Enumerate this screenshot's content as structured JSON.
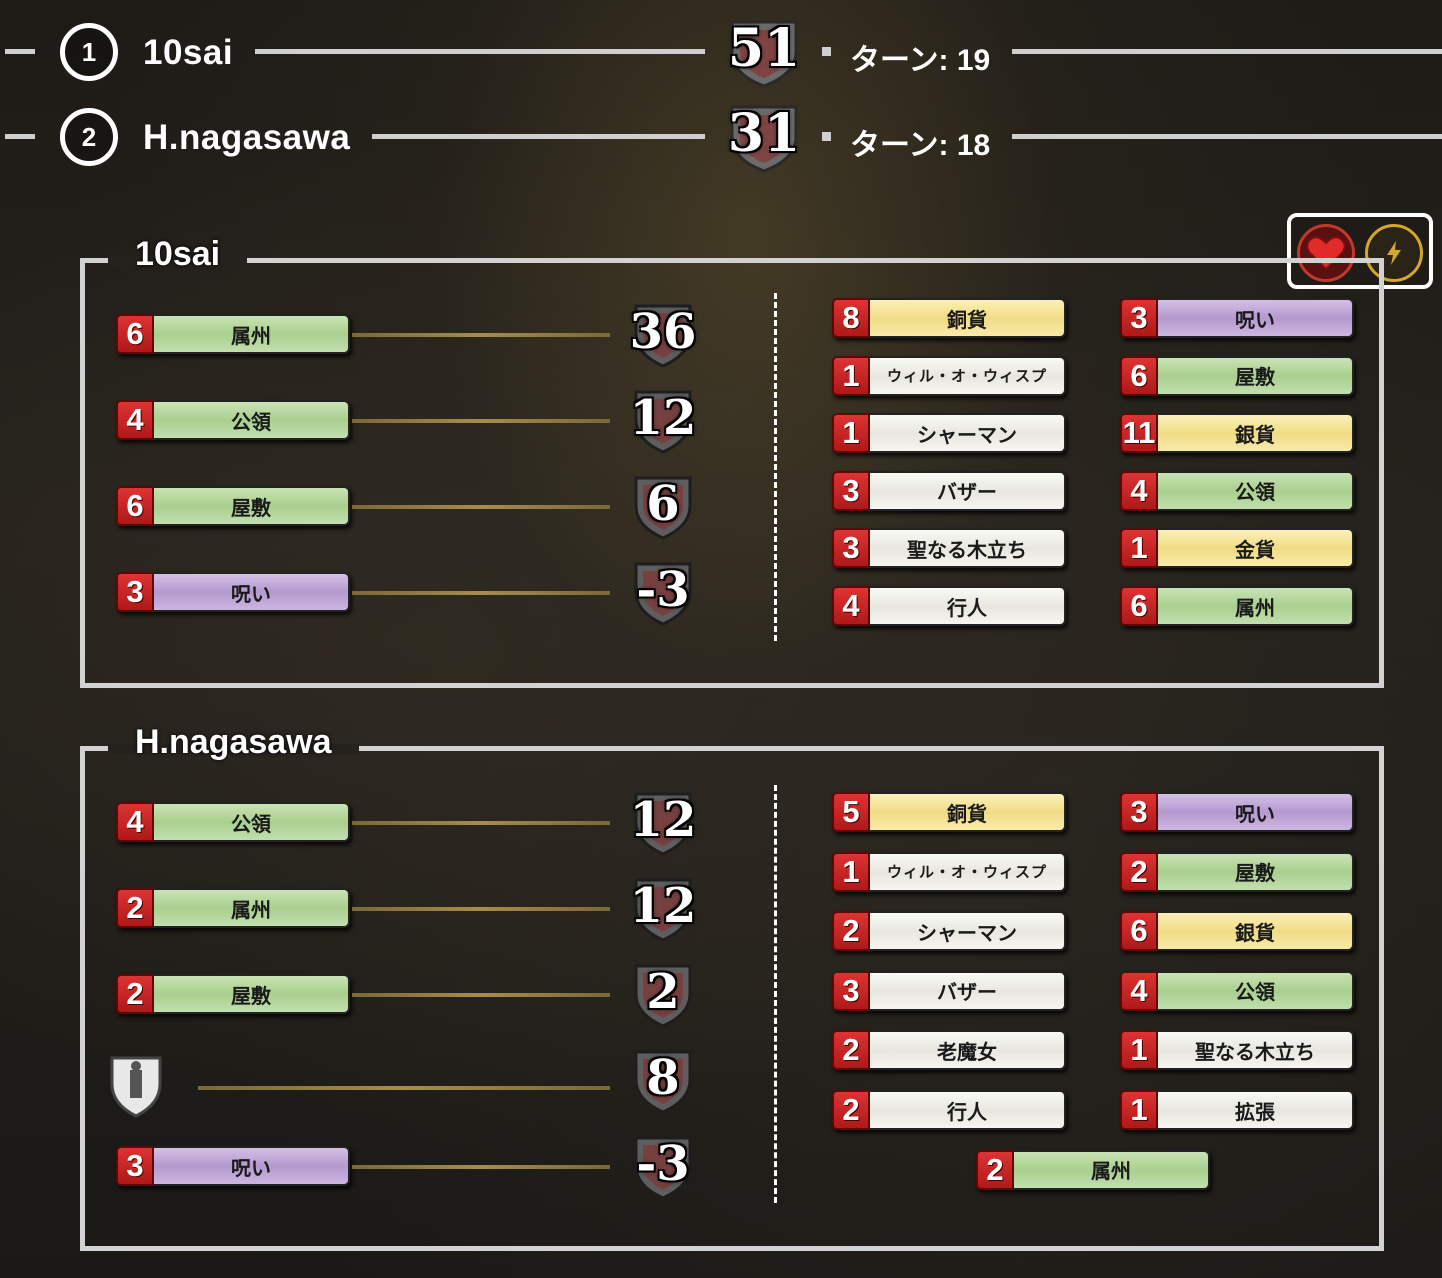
{
  "summary": [
    {
      "rank": "1",
      "name": "10sai",
      "vp": "51",
      "turns": "ターン: 19"
    },
    {
      "rank": "2",
      "name": "H.nagasawa",
      "vp": "31",
      "turns": "ターン: 18"
    }
  ],
  "buttons": {
    "like_icon": "heart-icon",
    "boost_icon": "lightning-icon"
  },
  "players": [
    {
      "name": "10sai",
      "vp_cards": [
        {
          "count": "6",
          "name": "属州",
          "color": "green",
          "vp": "36"
        },
        {
          "count": "4",
          "name": "公領",
          "color": "green",
          "vp": "12"
        },
        {
          "count": "6",
          "name": "屋敷",
          "color": "green",
          "vp": "6"
        },
        {
          "count": "3",
          "name": "呪い",
          "color": "purple",
          "vp": "-3"
        }
      ],
      "deck_left": [
        {
          "count": "8",
          "name": "銅貨",
          "color": "yellow"
        },
        {
          "count": "1",
          "name": "ウィル・オ・ウィスプ",
          "color": "white"
        },
        {
          "count": "1",
          "name": "シャーマン",
          "color": "white"
        },
        {
          "count": "3",
          "name": "バザー",
          "color": "white"
        },
        {
          "count": "3",
          "name": "聖なる木立ち",
          "color": "white"
        },
        {
          "count": "4",
          "name": "行人",
          "color": "white"
        }
      ],
      "deck_right": [
        {
          "count": "3",
          "name": "呪い",
          "color": "purple"
        },
        {
          "count": "6",
          "name": "屋敷",
          "color": "green"
        },
        {
          "count": "11",
          "name": "銀貨",
          "color": "yellow"
        },
        {
          "count": "4",
          "name": "公領",
          "color": "green"
        },
        {
          "count": "1",
          "name": "金貨",
          "color": "yellow"
        },
        {
          "count": "6",
          "name": "属州",
          "color": "green"
        }
      ]
    },
    {
      "name": "H.nagasawa",
      "vp_cards": [
        {
          "count": "4",
          "name": "公領",
          "color": "green",
          "vp": "12"
        },
        {
          "count": "2",
          "name": "属州",
          "color": "green",
          "vp": "12"
        },
        {
          "count": "2",
          "name": "屋敷",
          "color": "green",
          "vp": "2"
        },
        {
          "count": "",
          "name": "",
          "color": "token",
          "vp": "8"
        },
        {
          "count": "3",
          "name": "呪い",
          "color": "purple",
          "vp": "-3"
        }
      ],
      "deck_left": [
        {
          "count": "5",
          "name": "銅貨",
          "color": "yellow"
        },
        {
          "count": "1",
          "name": "ウィル・オ・ウィスプ",
          "color": "white"
        },
        {
          "count": "2",
          "name": "シャーマン",
          "color": "white"
        },
        {
          "count": "3",
          "name": "バザー",
          "color": "white"
        },
        {
          "count": "2",
          "name": "老魔女",
          "color": "white"
        },
        {
          "count": "2",
          "name": "行人",
          "color": "white"
        }
      ],
      "deck_right": [
        {
          "count": "3",
          "name": "呪い",
          "color": "purple"
        },
        {
          "count": "2",
          "name": "屋敷",
          "color": "green"
        },
        {
          "count": "6",
          "name": "銀貨",
          "color": "yellow"
        },
        {
          "count": "4",
          "name": "公領",
          "color": "green"
        },
        {
          "count": "1",
          "name": "聖なる木立ち",
          "color": "white"
        },
        {
          "count": "1",
          "name": "拡張",
          "color": "white"
        }
      ],
      "deck_extra": [
        {
          "count": "2",
          "name": "属州",
          "color": "green"
        }
      ]
    }
  ]
}
